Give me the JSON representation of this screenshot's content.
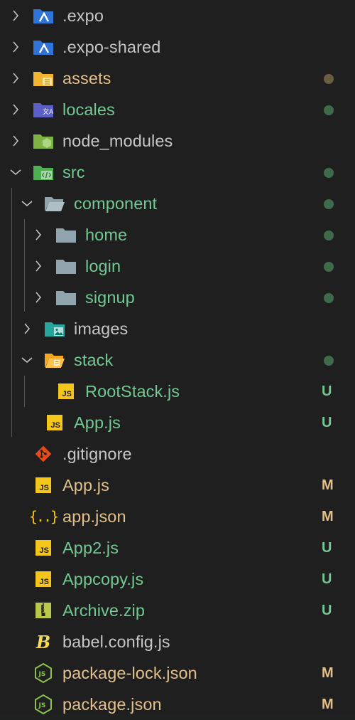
{
  "colors": {
    "background": "#1f1f1f",
    "untracked": "#73c991",
    "modified": "#e2c08d",
    "ignored": "#c6c6c6",
    "dot_green": "#3f6b4a",
    "dot_brown": "#6b5d42",
    "js_yellow": "#f4c51b"
  },
  "tree": {
    "expo": {
      "label": ".expo",
      "icon": "expo-folder-icon"
    },
    "expo_shared": {
      "label": ".expo-shared",
      "icon": "expo-folder-icon"
    },
    "assets": {
      "label": "assets",
      "icon": "assets-folder-icon"
    },
    "locales": {
      "label": "locales",
      "icon": "locales-folder-icon"
    },
    "node_modules": {
      "label": "node_modules",
      "icon": "node-folder-icon"
    },
    "src": {
      "label": "src",
      "icon": "src-folder-open-icon"
    },
    "component": {
      "label": "component",
      "icon": "folder-open-icon"
    },
    "home": {
      "label": "home",
      "icon": "folder-icon"
    },
    "login": {
      "label": "login",
      "icon": "folder-icon"
    },
    "signup": {
      "label": "signup",
      "icon": "folder-icon"
    },
    "images": {
      "label": "images",
      "icon": "images-folder-icon"
    },
    "stack": {
      "label": "stack",
      "icon": "folder-open-icon"
    },
    "rootstack": {
      "label": "RootStack.js",
      "icon": "js-file-icon",
      "status": "U",
      "badge": "JS"
    },
    "src_app": {
      "label": "App.js",
      "icon": "js-file-icon",
      "status": "U",
      "badge": "JS"
    },
    "gitignore": {
      "label": ".gitignore",
      "icon": "git-icon"
    },
    "app_js": {
      "label": "App.js",
      "icon": "js-file-icon",
      "status": "M",
      "badge": "JS"
    },
    "app_json": {
      "label": "app.json",
      "icon": "json-icon",
      "status": "M",
      "glyph": "{..}"
    },
    "app2": {
      "label": "App2.js",
      "icon": "js-file-icon",
      "status": "U",
      "badge": "JS"
    },
    "appcopy": {
      "label": "Appcopy.js",
      "icon": "js-file-icon",
      "status": "U",
      "badge": "JS"
    },
    "archive": {
      "label": "Archive.zip",
      "icon": "zip-icon",
      "status": "U"
    },
    "babel": {
      "label": "babel.config.js",
      "icon": "babel-icon",
      "glyph": "B"
    },
    "package_lock": {
      "label": "package-lock.json",
      "icon": "nodejs-icon",
      "status": "M",
      "glyph": "JS"
    },
    "package": {
      "label": "package.json",
      "icon": "nodejs-icon",
      "status": "M",
      "glyph": "JS"
    }
  }
}
